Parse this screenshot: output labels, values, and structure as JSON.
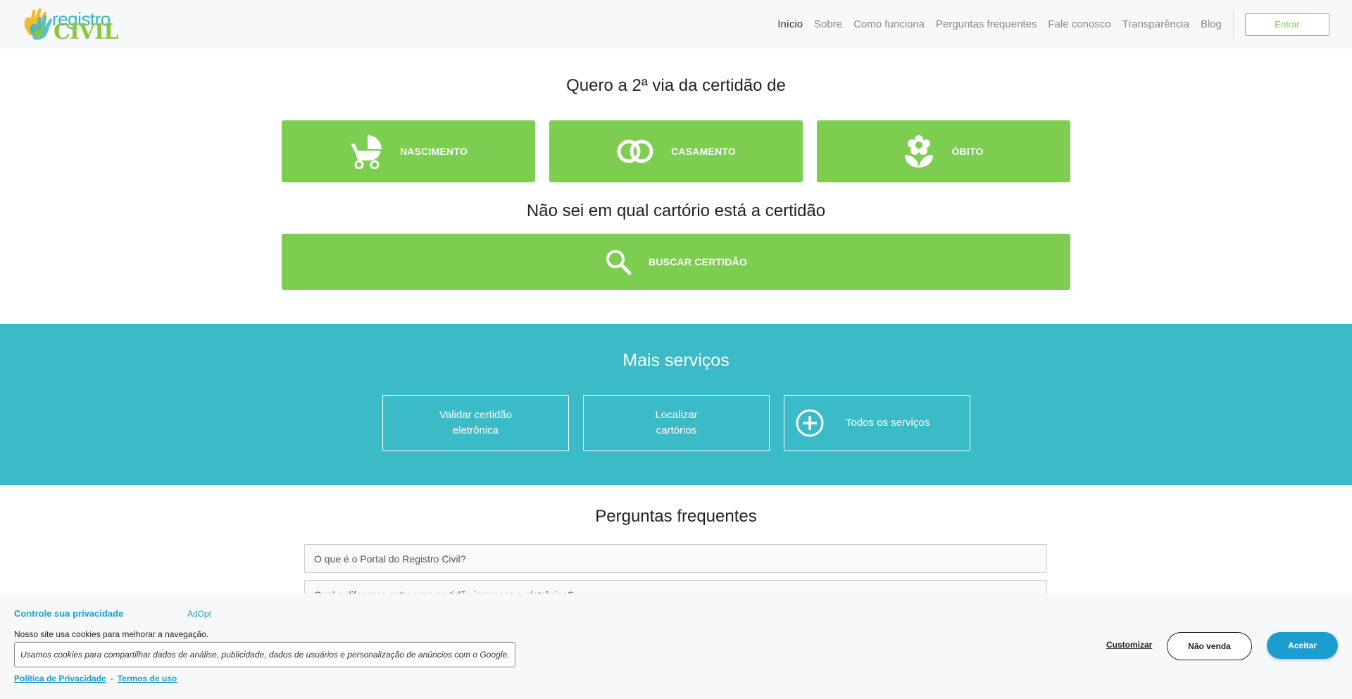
{
  "header": {
    "logo_top": "registro",
    "logo_bottom": "CIVIL",
    "nav": [
      "Início",
      "Sobre",
      "Como funciona",
      "Perguntas frequentes",
      "Fale conosco",
      "Transparência",
      "Blog"
    ],
    "login_label": "Entrar"
  },
  "certidao": {
    "title": "Quero a 2ª via da certidão de",
    "cards": [
      "NASCIMENTO",
      "CASAMENTO",
      "ÓBITO"
    ]
  },
  "busca": {
    "title": "Não sei em qual cartório está a certidão",
    "button": "BUSCAR CERTIDÃO"
  },
  "servicos": {
    "title": "Mais serviços",
    "items": [
      {
        "line1": "Validar certidão",
        "line2": "eletrônica"
      },
      {
        "line1": "Localizar",
        "line2": "cartórios"
      },
      {
        "label": "Todos os serviços"
      }
    ]
  },
  "faq": {
    "title": "Perguntas frequentes",
    "items": [
      "O que é o Portal do Registro Civil?",
      "Qual a diferença entre uma certidão impressa e eletrônica?"
    ]
  },
  "cookie": {
    "title": "Controle sua privacidade",
    "brand": "AdOpt",
    "text": "Nosso site usa cookies para melhorar a navegação.",
    "detail": "Usamos cookies para compartilhar dados de análise, publicidade, dados de usuários e personalização de anúncios com o Google.",
    "privacy_link": "Política de Privacidade",
    "separator": "-",
    "terms_link": "Termos de uso",
    "customize": "Customizar",
    "no_sell": "Não venda",
    "accept": "Aceitar"
  },
  "colors": {
    "green": "#7ccd50",
    "teal": "#3bbac8",
    "blue": "#1b9ecf"
  }
}
